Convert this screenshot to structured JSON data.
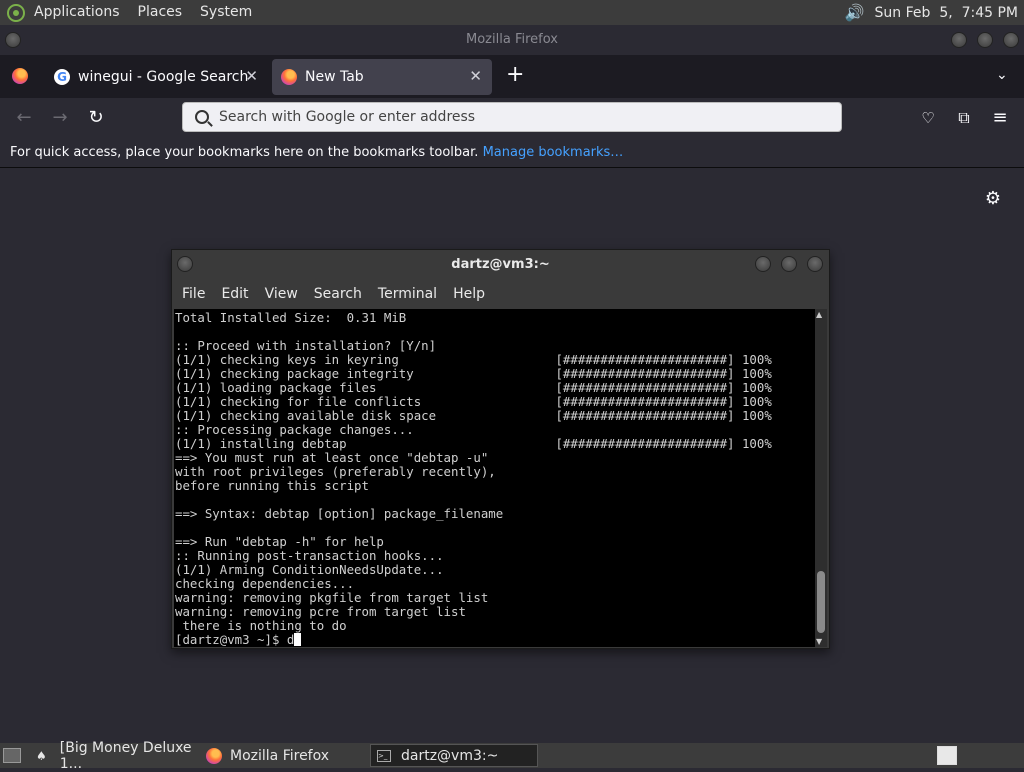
{
  "top_panel": {
    "menus": [
      "Applications",
      "Places",
      "System"
    ],
    "clock": "Sun Feb  5,  7:45 PM"
  },
  "firefox": {
    "window_title": "Mozilla Firefox",
    "tabs": [
      {
        "label": "winegui - Google Search"
      },
      {
        "label": "New Tab"
      }
    ],
    "urlbar_placeholder": "Search with Google or enter address",
    "bookmarks_text": "For quick access, place your bookmarks here on the bookmarks toolbar.",
    "bookmarks_link": "Manage bookmarks…"
  },
  "terminal": {
    "title": "dartz@vm3:~",
    "menus": [
      "File",
      "Edit",
      "View",
      "Search",
      "Terminal",
      "Help"
    ],
    "lines": [
      "Total Installed Size:  0.31 MiB",
      "",
      ":: Proceed with installation? [Y/n]",
      "(1/1) checking keys in keyring                     [######################] 100%",
      "(1/1) checking package integrity                   [######################] 100%",
      "(1/1) loading package files                        [######################] 100%",
      "(1/1) checking for file conflicts                  [######################] 100%",
      "(1/1) checking available disk space                [######################] 100%",
      ":: Processing package changes...",
      "(1/1) installing debtap                            [######################] 100%",
      "==> You must run at least once \"debtap -u\"",
      "with root privileges (preferably recently),",
      "before running this script",
      "",
      "==> Syntax: debtap [option] package_filename",
      "",
      "==> Run \"debtap -h\" for help",
      ":: Running post-transaction hooks...",
      "(1/1) Arming ConditionNeedsUpdate...",
      "checking dependencies...",
      "warning: removing pkgfile from target list",
      "warning: removing pcre from target list",
      " there is nothing to do"
    ],
    "prompt": "[dartz@vm3 ~]$ d"
  },
  "taskbar": {
    "tasks": [
      {
        "label": "[Big Money Deluxe 1..."
      },
      {
        "label": "Mozilla Firefox"
      },
      {
        "label": "dartz@vm3:~"
      }
    ]
  }
}
